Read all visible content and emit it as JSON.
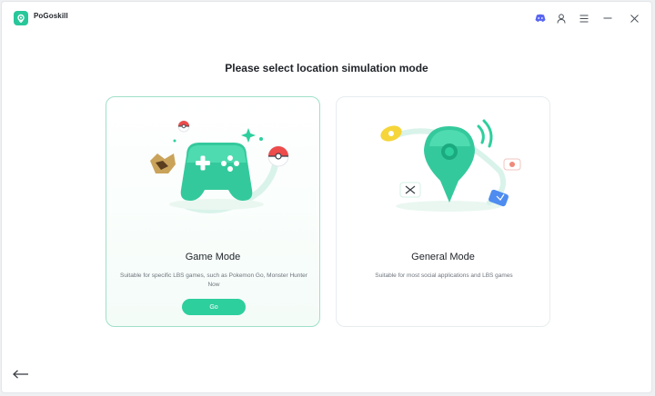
{
  "app": {
    "name": "PoGoskill"
  },
  "titlebar": {
    "icons": [
      "discord-icon",
      "user-icon",
      "menu-icon",
      "minimize-icon",
      "close-icon"
    ]
  },
  "main": {
    "heading": "Please select location simulation mode",
    "cards": [
      {
        "title": "Game Mode",
        "description": "Suitable for specific LBS games, such as Pokemon Go, Monster Hunter Now",
        "button_label": "Go",
        "selected": true
      },
      {
        "title": "General Mode",
        "description": "Suitable for most social applications and LBS games",
        "selected": false
      }
    ]
  },
  "colors": {
    "accent": "#2dcf9d",
    "discord": "#5865f2",
    "selected_border": "#9fe0c8"
  }
}
